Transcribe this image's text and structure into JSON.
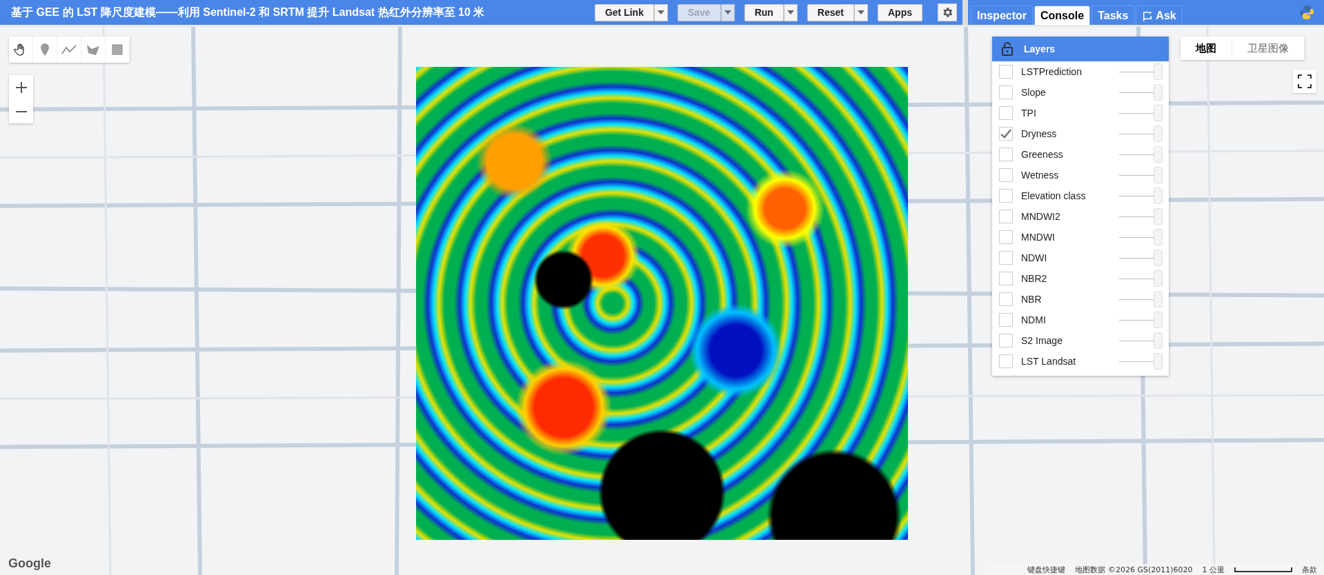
{
  "topbar": {
    "title": "基于 GEE 的 LST 降尺度建模——利用 Sentinel-2 和 SRTM 提升 Landsat 热红外分辨率至 10 米",
    "buttons": [
      {
        "label": "Get Link",
        "dropdown": true,
        "disabled": false
      },
      {
        "label": "Save",
        "dropdown": true,
        "disabled": true
      },
      {
        "label": "Run",
        "dropdown": true,
        "disabled": false
      },
      {
        "label": "Reset",
        "dropdown": true,
        "disabled": false
      },
      {
        "label": "Apps",
        "dropdown": false,
        "disabled": false
      }
    ]
  },
  "panel_tabs": [
    {
      "label": "Inspector",
      "selected": false
    },
    {
      "label": "Console",
      "selected": true
    },
    {
      "label": "Tasks",
      "selected": false
    },
    {
      "label": "Ask",
      "selected": false
    }
  ],
  "layers": {
    "title": "Layers",
    "items": [
      {
        "name": "LSTPrediction",
        "checked": false,
        "level": 1
      },
      {
        "name": "Slope",
        "checked": false,
        "level": 1
      },
      {
        "name": "TPI",
        "checked": false,
        "level": 1
      },
      {
        "name": "Dryness",
        "checked": true,
        "level": 1
      },
      {
        "name": "Greeness",
        "checked": false,
        "level": 1
      },
      {
        "name": "Wetness",
        "checked": false,
        "level": 1
      },
      {
        "name": "Elevation class",
        "checked": false,
        "level": 1
      },
      {
        "name": "MNDWI2",
        "checked": false,
        "level": 1
      },
      {
        "name": "MNDWI",
        "checked": false,
        "level": 1
      },
      {
        "name": "NDWI",
        "checked": false,
        "level": 1
      },
      {
        "name": "NBR2",
        "checked": false,
        "level": 1
      },
      {
        "name": "NBR",
        "checked": false,
        "level": 1
      },
      {
        "name": "NDMI",
        "checked": false,
        "level": 1
      },
      {
        "name": "S2 Image",
        "checked": false,
        "level": 1
      },
      {
        "name": "LST Landsat",
        "checked": false,
        "level": 1
      }
    ]
  },
  "map_types": [
    {
      "label": "地图",
      "selected": true
    },
    {
      "label": "卫星图像",
      "selected": false
    }
  ],
  "map_logo": "Google",
  "footer": {
    "shortcuts": "键盘快捷键",
    "attribution": "地图数据 ©2026 GS(2011)6020",
    "scale": "1 公里",
    "terms": "条款"
  }
}
